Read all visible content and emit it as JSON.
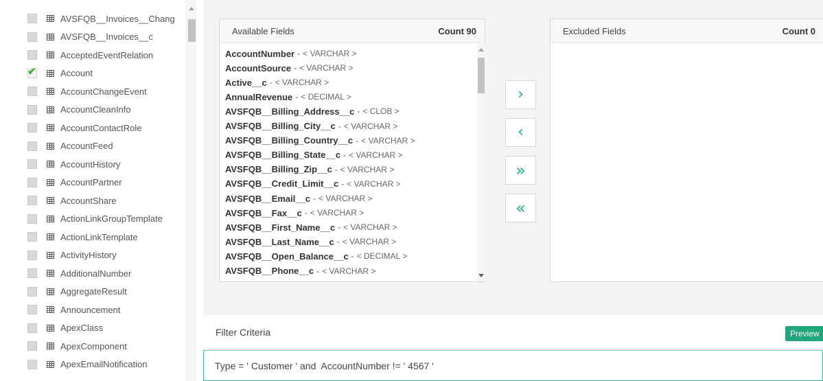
{
  "objects": [
    {
      "label": "AVSFQB__Invoices__Chang",
      "checked": false
    },
    {
      "label": "AVSFQB__Invoices__c",
      "checked": false
    },
    {
      "label": "AcceptedEventRelation",
      "checked": false
    },
    {
      "label": "Account",
      "checked": true
    },
    {
      "label": "AccountChangeEvent",
      "checked": false
    },
    {
      "label": "AccountCleanInfo",
      "checked": false
    },
    {
      "label": "AccountContactRole",
      "checked": false
    },
    {
      "label": "AccountFeed",
      "checked": false
    },
    {
      "label": "AccountHistory",
      "checked": false
    },
    {
      "label": "AccountPartner",
      "checked": false
    },
    {
      "label": "AccountShare",
      "checked": false
    },
    {
      "label": "ActionLinkGroupTemplate",
      "checked": false
    },
    {
      "label": "ActionLinkTemplate",
      "checked": false
    },
    {
      "label": "ActivityHistory",
      "checked": false
    },
    {
      "label": "AdditionalNumber",
      "checked": false
    },
    {
      "label": "AggregateResult",
      "checked": false
    },
    {
      "label": "Announcement",
      "checked": false
    },
    {
      "label": "ApexClass",
      "checked": false
    },
    {
      "label": "ApexComponent",
      "checked": false
    },
    {
      "label": "ApexEmailNotification",
      "checked": false
    }
  ],
  "available": {
    "title": "Available Fields",
    "count_label": "Count 90",
    "fields": [
      {
        "name": "AccountNumber",
        "sep": "-",
        "type": "< VARCHAR >"
      },
      {
        "name": "AccountSource",
        "sep": "-",
        "type": "< VARCHAR >"
      },
      {
        "name": "Active__c",
        "sep": "-",
        "type": "< VARCHAR >"
      },
      {
        "name": "AnnualRevenue",
        "sep": "-",
        "type": "< DECIMAL >"
      },
      {
        "name": "AVSFQB__Billing_Address__c",
        "sep": "-",
        "type": "< CLOB >"
      },
      {
        "name": "AVSFQB__Billing_City__c",
        "sep": "-",
        "type": "< VARCHAR >"
      },
      {
        "name": "AVSFQB__Billing_Country__c",
        "sep": "-",
        "type": "< VARCHAR >"
      },
      {
        "name": "AVSFQB__Billing_State__c",
        "sep": "-",
        "type": "< VARCHAR >"
      },
      {
        "name": "AVSFQB__Billing_Zip__c",
        "sep": "-",
        "type": "< VARCHAR >"
      },
      {
        "name": "AVSFQB__Credit_Limit__c",
        "sep": "-",
        "type": "< VARCHAR >"
      },
      {
        "name": "AVSFQB__Email__c",
        "sep": "-",
        "type": "< VARCHAR >"
      },
      {
        "name": "AVSFQB__Fax__c",
        "sep": "-",
        "type": "< VARCHAR >"
      },
      {
        "name": "AVSFQB__First_Name__c",
        "sep": "-",
        "type": "< VARCHAR >"
      },
      {
        "name": "AVSFQB__Last_Name__c",
        "sep": "-",
        "type": "< VARCHAR >"
      },
      {
        "name": "AVSFQB__Open_Balance__c",
        "sep": "-",
        "type": "< DECIMAL >"
      },
      {
        "name": "AVSFQB__Phone__c",
        "sep": "-",
        "type": "< VARCHAR >"
      }
    ]
  },
  "excluded": {
    "title": "Excluded Fields",
    "count_label": "Count 0"
  },
  "move_buttons": {
    "move_right": "›",
    "move_left": "‹",
    "move_all_right": "»",
    "move_all_left": "«"
  },
  "filter": {
    "title": "Filter Criteria",
    "preview_label": "Preview",
    "value": "Type = ' Customer ' and  AccountNumber != ' 4567 '"
  },
  "colors": {
    "accent": "#1aab8a",
    "preview_bg": "#21a67a",
    "check_tick": "#3fae2a"
  }
}
